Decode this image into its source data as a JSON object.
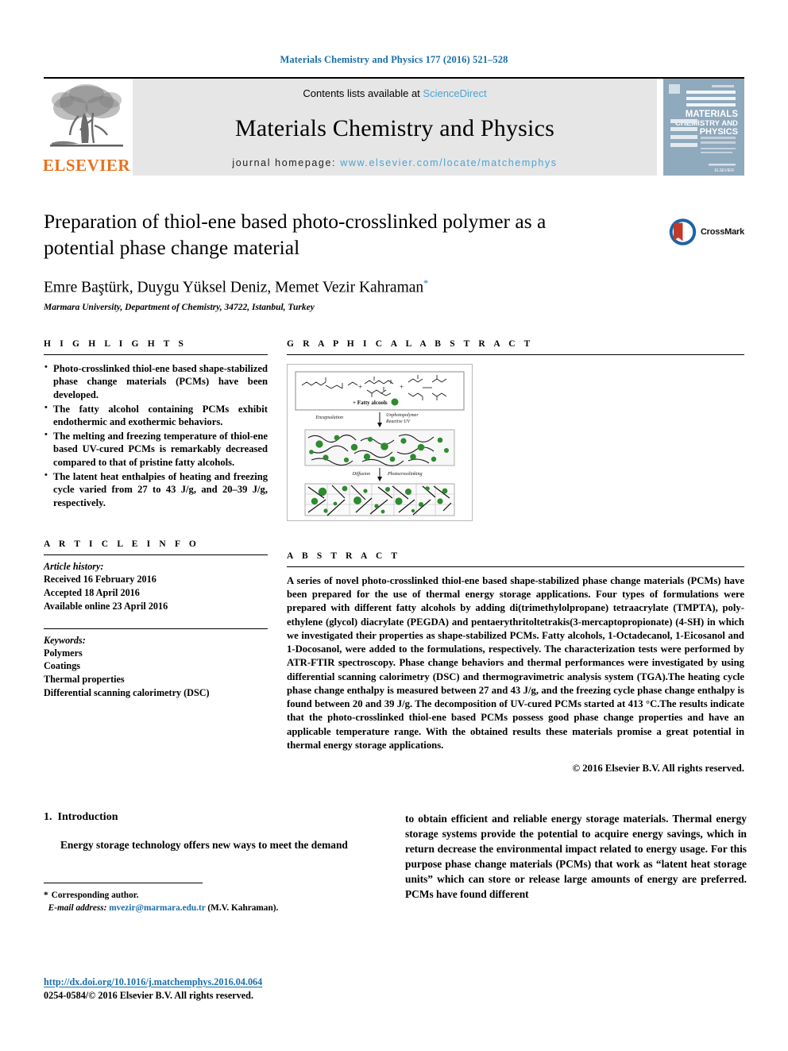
{
  "running_head": "Materials Chemistry and Physics 177 (2016) 521–528",
  "masthead": {
    "contents_prefix": "Contents lists available at ",
    "sciencedirect": "ScienceDirect",
    "journal_name": "Materials Chemistry and Physics",
    "homepage_prefix": "journal homepage: ",
    "homepage_url": "www.elsevier.com/locate/matchemphys",
    "publisher": "ELSEVIER",
    "cover_lines": [
      "MATERIALS",
      "CHEMISTRY AND",
      "PHYSICS"
    ],
    "link_color": "#4aa3d5"
  },
  "article": {
    "title": "Preparation of thiol-ene based photo-crosslinked polymer as a potential phase change material",
    "authors": "Emre Baştürk, Duygu Yüksel Deniz, Memet Vezir Kahraman",
    "corresponding_marker": "*",
    "affiliation": "Marmara University, Department of Chemistry, 34722, Istanbul, Turkey",
    "crossmark_label": "CrossMark"
  },
  "sections": {
    "highlights_heading": "H I G H L I G H T S",
    "graphical_abstract_heading": "G R A P H I C A L   A B S T R A C T",
    "article_info_heading": "A R T I C L E   I N F O",
    "abstract_heading": "A B S T R A C T"
  },
  "highlights": [
    "Photo-crosslinked thiol-ene based shape-stabilized phase change materials (PCMs) have been developed.",
    "The fatty alcohol containing PCMs exhibit endothermic and exothermic behaviors.",
    "The melting and freezing temperature of thiol-ene based UV-cured PCMs is remarkably decreased compared to that of pristine fatty alcohols.",
    "The latent heat enthalpies of heating and freezing cycle varied from 27 to 43 J/g, and 20–39 J/g, respectively."
  ],
  "article_info": {
    "history_label": "Article history:",
    "history": [
      "Received 16 February 2016",
      "Accepted 18 April 2016",
      "Available online 23 April 2016"
    ],
    "keywords_label": "Keywords:",
    "keywords": [
      "Polymers",
      "Coatings",
      "Thermal properties",
      "Differential scanning calorimetry (DSC)"
    ]
  },
  "abstract": {
    "text": "A series of novel photo-crosslinked thiol-ene based shape-stabilized phase change materials (PCMs) have been prepared for the use of thermal energy storage applications. Four types of formulations were prepared with different fatty alcohols by adding di(trimethylolpropane) tetraacrylate (TMPTA), poly-ethylene (glycol) diacrylate (PEGDA) and pentaerythritoltetrakis(3-mercaptopropionate) (4-SH) in which we investigated their properties as shape-stabilized PCMs. Fatty alcohols, 1-Octadecanol, 1-Eicosanol and 1-Docosanol, were added to the formulations, respectively. The characterization tests were performed by ATR-FTIR spectroscopy. Phase change behaviors and thermal performances were investigated by using differential scanning calorimetry (DSC) and thermogravimetric analysis system (TGA).The heating cycle phase change enthalpy is measured between 27 and 43 J/g, and the freezing cycle phase change enthalpy is found between 20 and 39 J/g. The decomposition of UV-cured PCMs started at 413 °C.The results indicate that the photo-crosslinked thiol-ene based PCMs possess good phase change properties and have an applicable temperature range. With the obtained results these materials promise a great potential in thermal energy storage applications.",
    "copyright": "© 2016 Elsevier B.V. All rights reserved."
  },
  "graphical_abstract": {
    "caption_encapsulation": "Encapsulation",
    "caption_photopolymer": "Unphotopolymer",
    "caption_reactive": "Reactive UV",
    "caption_fatty": "+ Fatty alcools",
    "caption_diffusion": "Diffusion",
    "caption_crosslinking": "Photocrosslinking",
    "particle_color": "#2e8b2e"
  },
  "body": {
    "intro_number": "1.",
    "intro_title": "Introduction",
    "left_para": "Energy storage technology offers new ways to meet the demand",
    "right_para": "to obtain efficient and reliable energy storage materials. Thermal energy storage systems provide the potential to acquire energy savings, which in return decrease the environmental impact related to energy usage. For this purpose phase change materials (PCMs) that work as “latent heat storage units” which can store or release large amounts of energy are preferred. PCMs have found different"
  },
  "footnote": {
    "star": "*",
    "corresponding": "Corresponding author.",
    "email_label": "E-mail address:",
    "email": "mvezir@marmara.edu.tr",
    "email_suffix": "(M.V. Kahraman)."
  },
  "footer": {
    "doi": "http://dx.doi.org/10.1016/j.matchemphys.2016.04.064",
    "issn": "0254-0584/© 2016 Elsevier B.V. All rights reserved."
  }
}
